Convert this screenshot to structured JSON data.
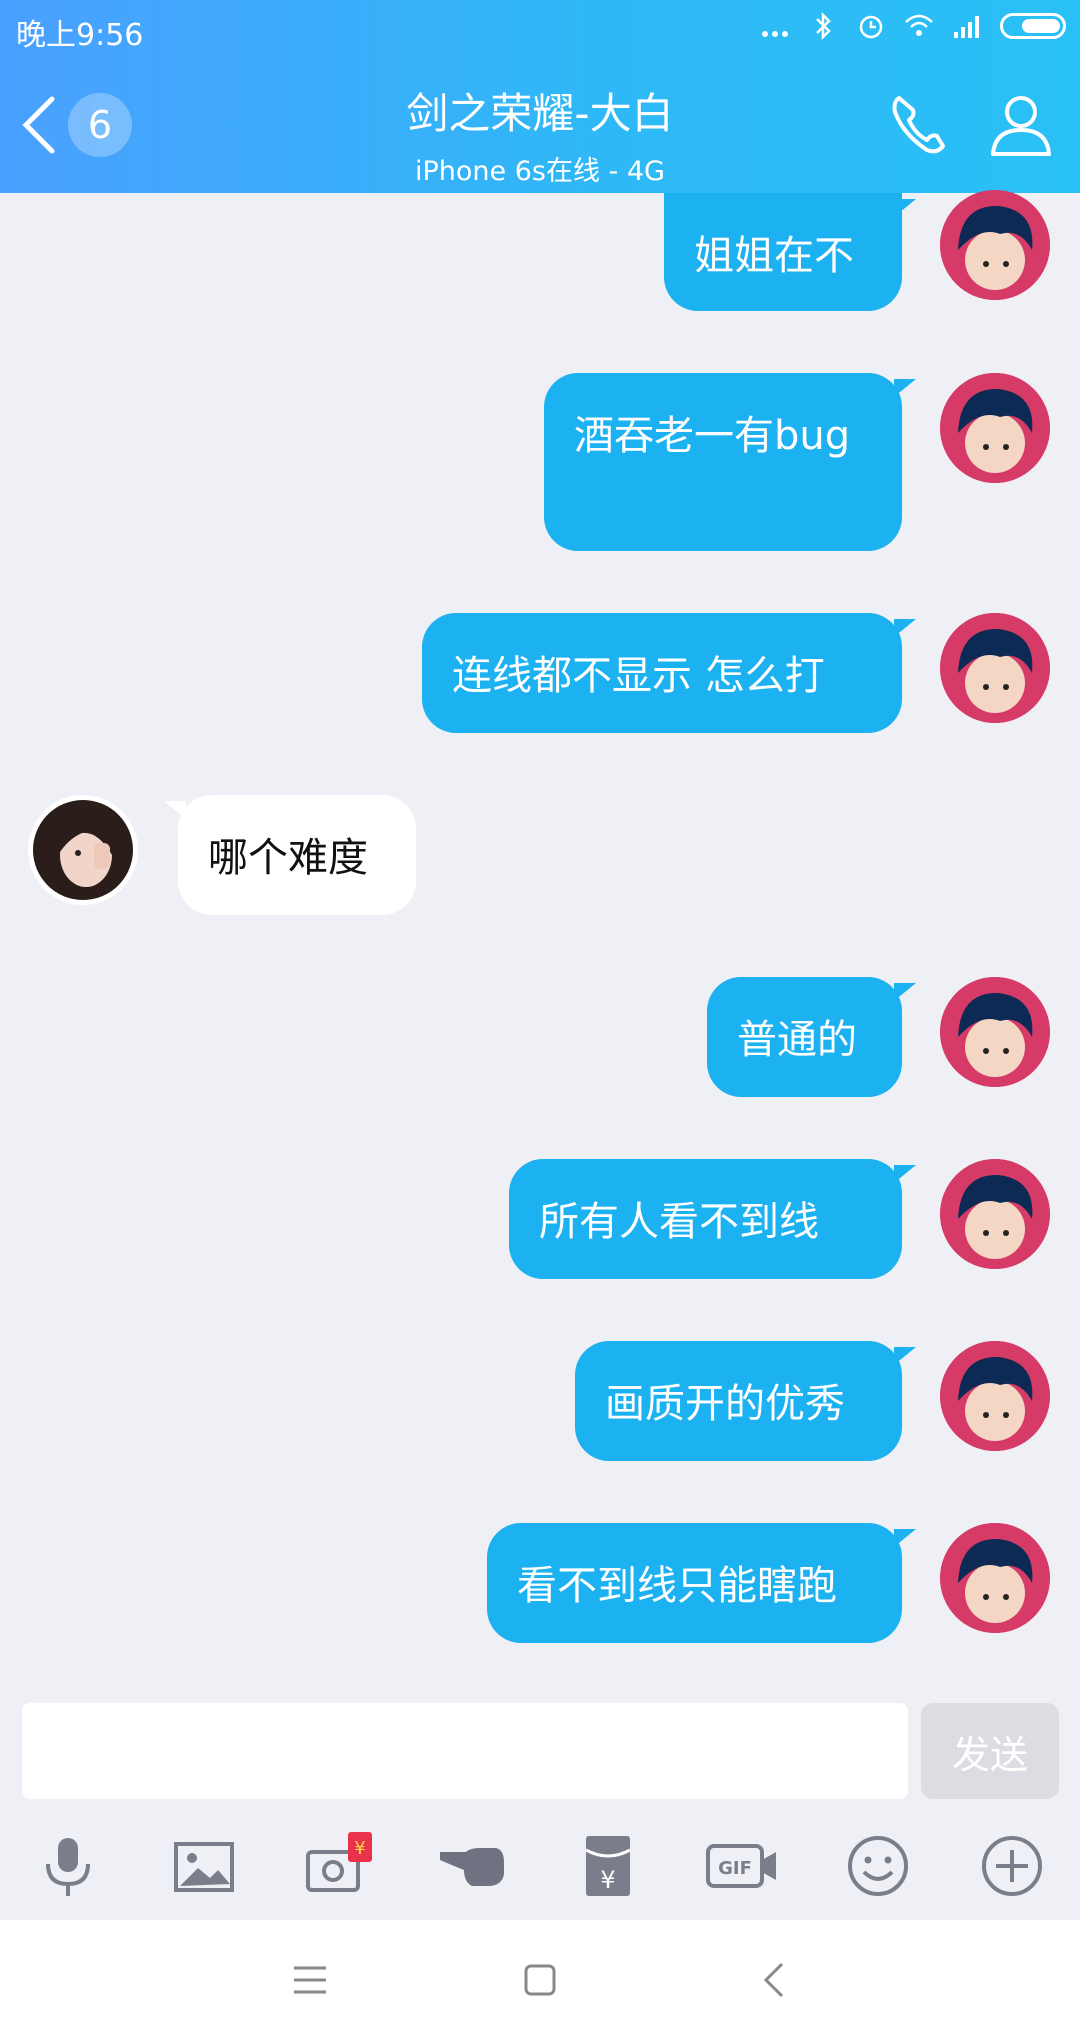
{
  "status": {
    "time": "晚上9:56"
  },
  "header": {
    "title": "剑之荣耀-大白",
    "subtitle": "iPhone 6s在线 - 4G",
    "unread_count": "6",
    "icons": [
      "back-icon",
      "phone-icon",
      "profile-icon"
    ]
  },
  "messages": [
    {
      "from": "me",
      "text": "姐姐在不"
    },
    {
      "from": "me",
      "text": "酒吞老一有bug"
    },
    {
      "from": "me",
      "text": "连线都不显示  怎么打"
    },
    {
      "from": "other",
      "text": "哪个难度"
    },
    {
      "from": "me",
      "text": "普通的"
    },
    {
      "from": "me",
      "text": "所有人看不到线"
    },
    {
      "from": "me",
      "text": "画质开的优秀"
    },
    {
      "from": "me",
      "text": "看不到线只能瞎跑"
    }
  ],
  "input": {
    "value": "",
    "send_label": "发送"
  },
  "toolbar": [
    "mic-icon",
    "image-icon",
    "camera-redpacket-icon",
    "poke-icon",
    "red-envelope-icon",
    "gif-icon",
    "emoji-icon",
    "plus-icon"
  ],
  "colors": {
    "accent": "#1cb1f1",
    "header_start": "#4aa0ff",
    "header_end": "#29c0f5",
    "badge_red": "#e8334b"
  }
}
